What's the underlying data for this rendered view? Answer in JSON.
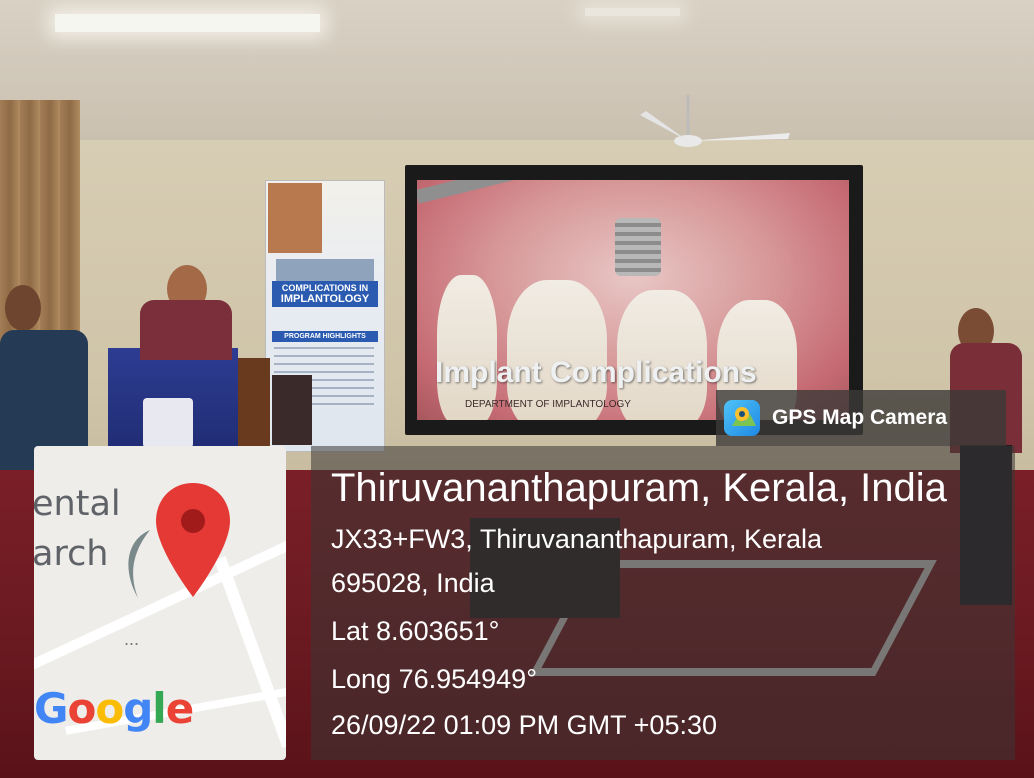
{
  "slide": {
    "title": "Implant Complications",
    "department": "DEPARTMENT OF IMPLANTOLOGY"
  },
  "poster": {
    "title_line1": "COMPLICATIONS IN",
    "title_line2": "IMPLANTOLOGY",
    "highlights": "PROGRAM HIGHLIGHTS"
  },
  "gps_badge": {
    "label": "GPS Map Camera",
    "icon": "map-pin-app-icon"
  },
  "map": {
    "label_line1": "ental",
    "label_line2": "arch",
    "ellipsis": "...",
    "provider": "Google",
    "pin_color": "#e53935"
  },
  "location": {
    "city": "Thiruvananthapuram, Kerala, India",
    "address_line1": "JX33+FW3, Thiruvananthapuram, Kerala",
    "address_line2": "695028, India",
    "lat": "Lat 8.603651°",
    "long": "Long 76.954949°",
    "datetime": "26/09/22 01:09 PM GMT +05:30"
  }
}
